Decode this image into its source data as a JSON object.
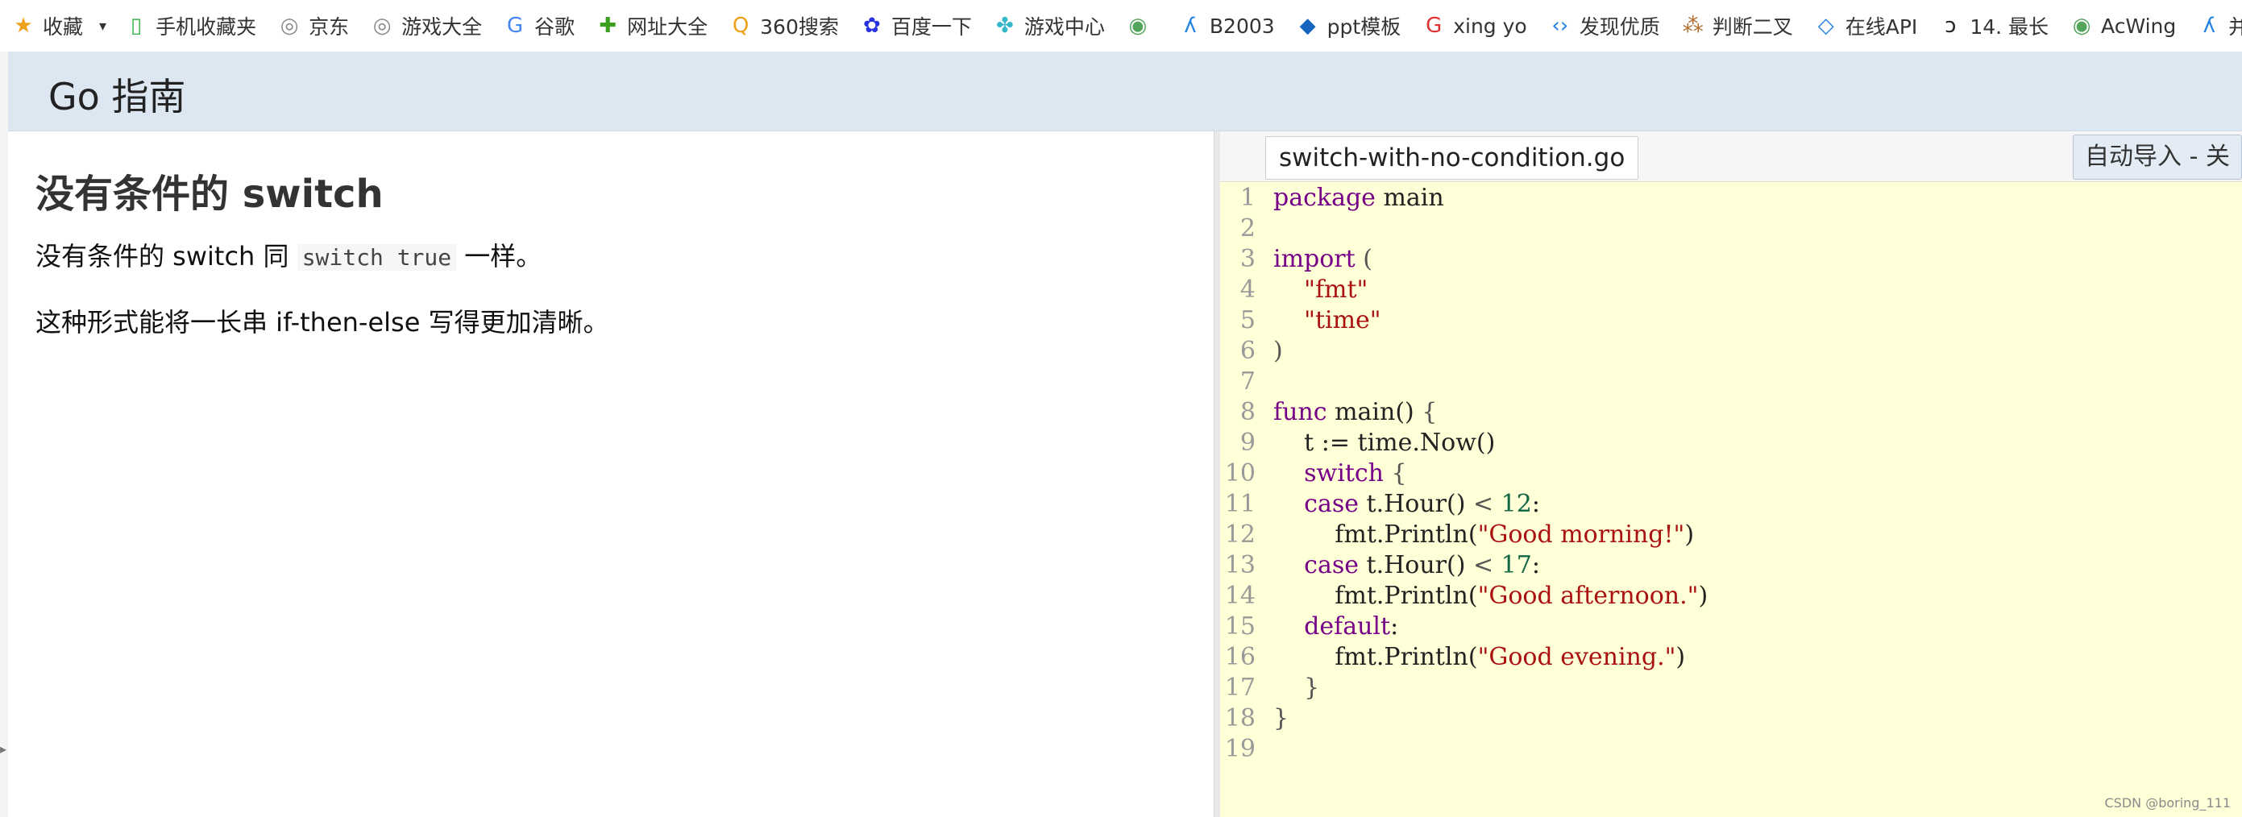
{
  "bookmarks": [
    {
      "icon": "star-icon",
      "glyph": "★",
      "color": "#f0a11a",
      "label": "收藏"
    },
    {
      "icon": "mobile-icon",
      "glyph": "▯",
      "color": "#3ab34a",
      "label": "手机收藏夹"
    },
    {
      "icon": "globe-icon",
      "glyph": "◎",
      "color": "#888888",
      "label": "京东"
    },
    {
      "icon": "globe-icon",
      "glyph": "◎",
      "color": "#888888",
      "label": "游戏大全"
    },
    {
      "icon": "google-icon",
      "glyph": "G",
      "color": "#4285f4",
      "label": "谷歌"
    },
    {
      "icon": "plus-circle-icon",
      "glyph": "✚",
      "color": "#3a9e1f",
      "label": "网址大全"
    },
    {
      "icon": "search-360-icon",
      "glyph": "Q",
      "color": "#f0a11a",
      "label": "360搜索"
    },
    {
      "icon": "baidu-paw-icon",
      "glyph": "✿",
      "color": "#2932e1",
      "label": "百度一下"
    },
    {
      "icon": "game-center-icon",
      "glyph": "✤",
      "color": "#35b9c9",
      "label": "游戏中心"
    },
    {
      "icon": "acwing-icon",
      "glyph": "◉",
      "color": "#52a55a",
      "label": ""
    },
    {
      "icon": "bilibili-blue-icon",
      "glyph": "ʎ",
      "color": "#1e80e0",
      "label": "B2003"
    },
    {
      "icon": "ppt-icon",
      "glyph": "◆",
      "color": "#1565c0",
      "label": "ppt模板"
    },
    {
      "icon": "red-g-icon",
      "glyph": "G",
      "color": "#e03030",
      "label": "xing yo"
    },
    {
      "icon": "code-icon",
      "glyph": "‹›",
      "color": "#1e80e0",
      "label": "发现优质"
    },
    {
      "icon": "binary-icon",
      "glyph": "⁂",
      "color": "#b06a2a",
      "label": "判断二叉"
    },
    {
      "icon": "online-api-icon",
      "glyph": "◇",
      "color": "#1e80e0",
      "label": "在线API"
    },
    {
      "icon": "leetcode-icon",
      "glyph": "ɔ",
      "color": "#222222",
      "label": "14. 最长"
    },
    {
      "icon": "acwing-icon",
      "glyph": "◉",
      "color": "#52a55a",
      "label": "AcWing"
    },
    {
      "icon": "bilibili-blue-icon",
      "glyph": "ʎ",
      "color": "#1e80e0",
      "label": "并查集板"
    }
  ],
  "dropdown_glyph": "▾",
  "header": {
    "title": "Go 指南"
  },
  "lesson": {
    "title": "没有条件的 switch",
    "para1_before": "没有条件的 switch 同 ",
    "para1_code": "switch true",
    "para1_after": " 一样。",
    "para2": "这种形式能将一长串 if-then-else 写得更加清晰。"
  },
  "editor": {
    "file_tab": "switch-with-no-condition.go",
    "import_button": "自动导入 - 关",
    "lines": [
      [
        {
          "t": "package",
          "c": "kw"
        },
        {
          "t": " main",
          "c": ""
        }
      ],
      [],
      [
        {
          "t": "import",
          "c": "kw"
        },
        {
          "t": " (",
          "c": "punc"
        }
      ],
      [
        {
          "t": "    ",
          "c": ""
        },
        {
          "t": "\"fmt\"",
          "c": "str"
        }
      ],
      [
        {
          "t": "    ",
          "c": ""
        },
        {
          "t": "\"time\"",
          "c": "str"
        }
      ],
      [
        {
          "t": ")",
          "c": "punc"
        }
      ],
      [],
      [
        {
          "t": "func",
          "c": "kw"
        },
        {
          "t": " main() ",
          "c": ""
        },
        {
          "t": "{",
          "c": "punc"
        }
      ],
      [
        {
          "t": "    t := time.Now()",
          "c": ""
        }
      ],
      [
        {
          "t": "    ",
          "c": ""
        },
        {
          "t": "switch",
          "c": "kw"
        },
        {
          "t": " {",
          "c": "punc"
        }
      ],
      [
        {
          "t": "    ",
          "c": ""
        },
        {
          "t": "case",
          "c": "kw"
        },
        {
          "t": " t.Hour() ",
          "c": ""
        },
        {
          "t": "<",
          "c": "punc"
        },
        {
          "t": " ",
          "c": ""
        },
        {
          "t": "12",
          "c": "num"
        },
        {
          "t": ":",
          "c": ""
        }
      ],
      [
        {
          "t": "        fmt.Println(",
          "c": ""
        },
        {
          "t": "\"Good morning!\"",
          "c": "str"
        },
        {
          "t": ")",
          "c": ""
        }
      ],
      [
        {
          "t": "    ",
          "c": ""
        },
        {
          "t": "case",
          "c": "kw"
        },
        {
          "t": " t.Hour() ",
          "c": ""
        },
        {
          "t": "<",
          "c": "punc"
        },
        {
          "t": " ",
          "c": ""
        },
        {
          "t": "17",
          "c": "num"
        },
        {
          "t": ":",
          "c": ""
        }
      ],
      [
        {
          "t": "        fmt.Println(",
          "c": ""
        },
        {
          "t": "\"Good afternoon.\"",
          "c": "str"
        },
        {
          "t": ")",
          "c": ""
        }
      ],
      [
        {
          "t": "    ",
          "c": ""
        },
        {
          "t": "default",
          "c": "kw"
        },
        {
          "t": ":",
          "c": ""
        }
      ],
      [
        {
          "t": "        fmt.Println(",
          "c": ""
        },
        {
          "t": "\"Good evening.\"",
          "c": "str"
        },
        {
          "t": ")",
          "c": ""
        }
      ],
      [
        {
          "t": "    }",
          "c": "punc"
        }
      ],
      [
        {
          "t": "}",
          "c": "punc"
        }
      ],
      []
    ]
  },
  "watermark": "CSDN @boring_111",
  "colors": {
    "header_bg": "#dde7f2",
    "editor_bg": "#ffffd8",
    "keyword": "#770088",
    "string": "#aa1111",
    "number": "#116644"
  }
}
